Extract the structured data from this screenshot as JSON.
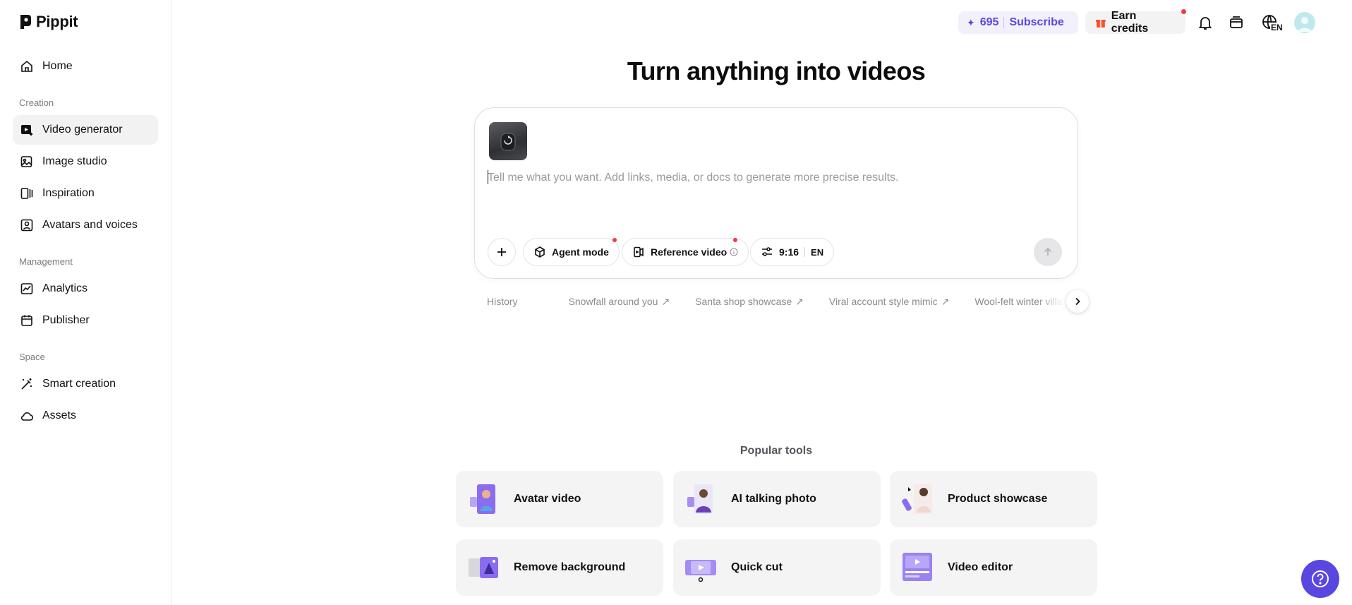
{
  "brand": {
    "name": "Pippit"
  },
  "sidebar": {
    "home": "Home",
    "sections": {
      "creation": "Creation",
      "management": "Management",
      "space": "Space"
    },
    "items": {
      "video_generator": "Video generator",
      "image_studio": "Image studio",
      "inspiration": "Inspiration",
      "avatars_voices": "Avatars and voices",
      "analytics": "Analytics",
      "publisher": "Publisher",
      "smart_creation": "Smart creation",
      "assets": "Assets"
    }
  },
  "topbar": {
    "credits": "695",
    "subscribe": "Subscribe",
    "earn_credits": "Earn credits",
    "language": "EN"
  },
  "main": {
    "title": "Turn anything into videos",
    "prompt_placeholder": "Tell me what you want. Add links, media, or docs to generate more precise results.",
    "chips": {
      "agent_mode": "Agent mode",
      "reference_video": "Reference video",
      "ratio": "9:16",
      "language": "EN"
    },
    "history_label": "History",
    "suggestions": [
      "Snowfall around you",
      "Santa shop showcase",
      "Viral account style mimic",
      "Wool-felt winter villa"
    ],
    "popular_tools_label": "Popular tools",
    "tools": [
      "Avatar video",
      "AI talking photo",
      "Product showcase",
      "Remove background",
      "Quick cut",
      "Video editor"
    ]
  },
  "colors": {
    "accent": "#5a47e0",
    "notification": "#f2394a",
    "card_bg": "#f4f4f5"
  }
}
